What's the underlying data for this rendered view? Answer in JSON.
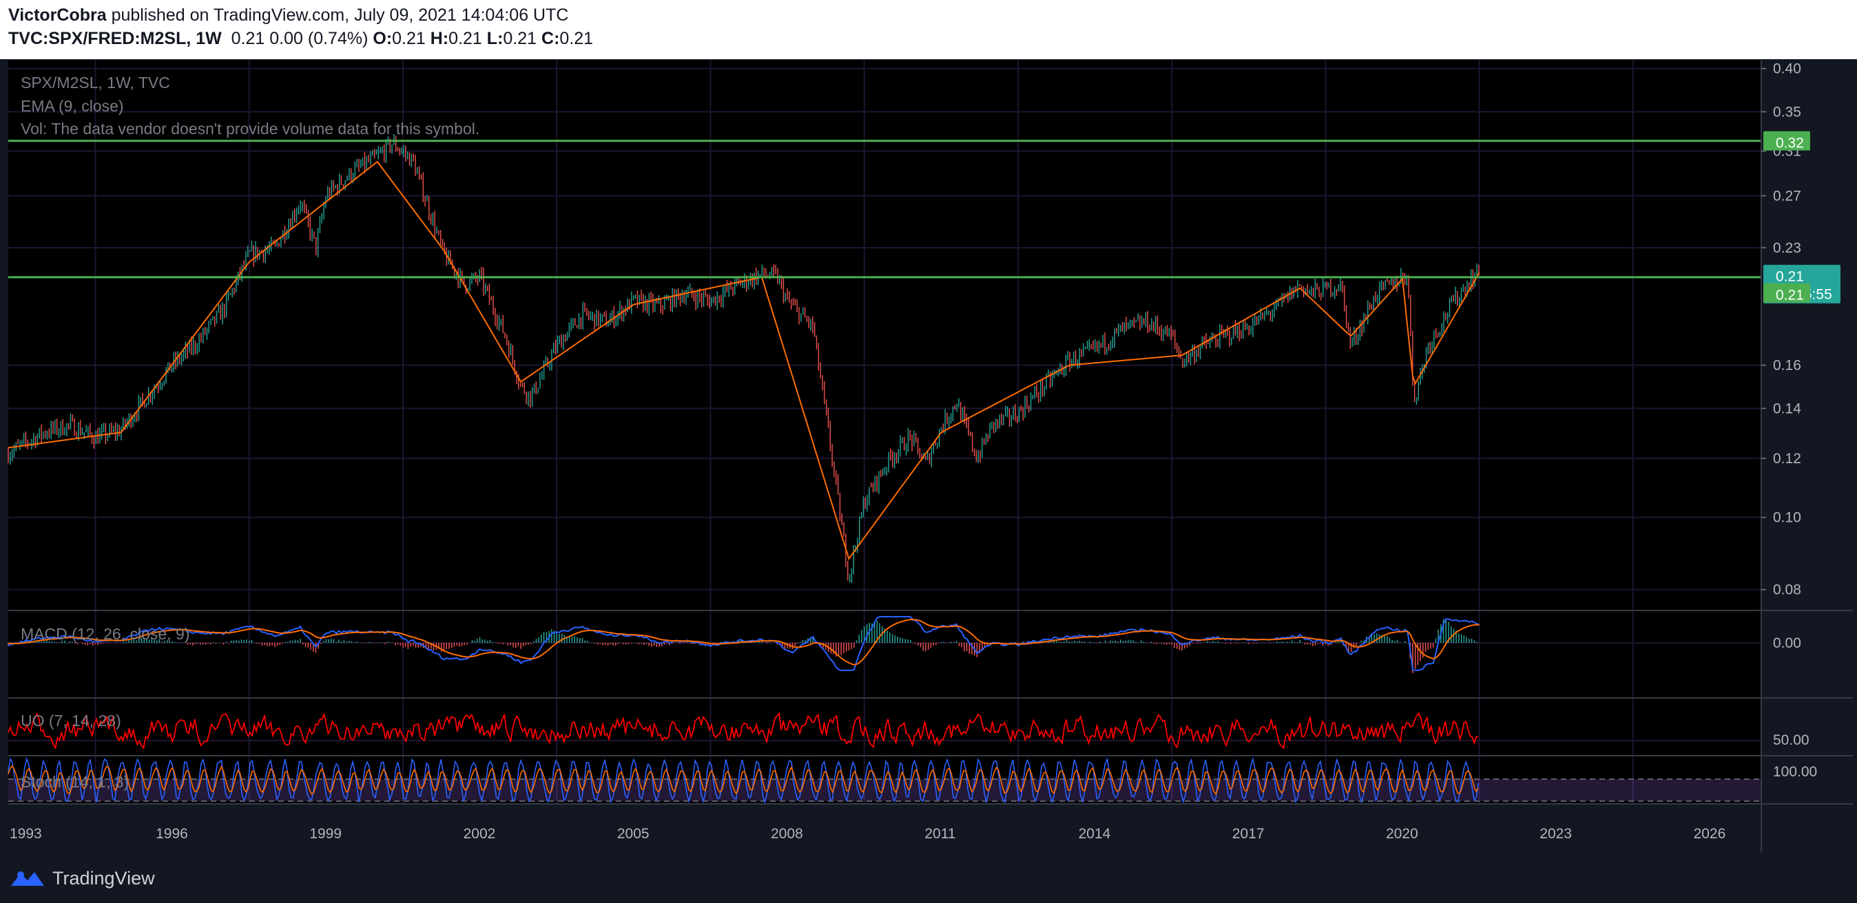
{
  "header": {
    "author": "VictorCobra",
    "published_text": "published on TradingView.com, July 09, 2021 14:04:06 UTC",
    "symbol": "TVC:SPX/FRED:M2SL, 1W",
    "last": "0.21",
    "change": "0.00 (0.74%)",
    "o_label": "O:",
    "o": "0.21",
    "h_label": "H:",
    "h": "0.21",
    "l_label": "L:",
    "l": "0.21",
    "c_label": "C:",
    "c": "0.21"
  },
  "legend": {
    "main": "SPX/M2SL, 1W, TVC",
    "ema": "EMA (9, close)",
    "vol": "Vol: The data vendor doesn't provide volume data for this symbol.",
    "macd": "MACD (12, 26, close, 9)",
    "uo": "UO (7, 14, 28)",
    "stoch": "Stoch (14, 1, 3)"
  },
  "price_axis": {
    "main_ticks": [
      "0.40",
      "0.35",
      "0.31",
      "0.27",
      "0.23",
      "0.16",
      "0.14",
      "0.12",
      "0.10",
      "0.08"
    ],
    "macd_tick": "0.00",
    "uo_tick": "50.00",
    "stoch_tick": "100.00",
    "last_price_label": "0.21",
    "countdown": "06:05:55",
    "hline_high_label": "0.32",
    "hline_low_label": "0.21",
    "ema_label": "0.21"
  },
  "time_axis": [
    "1993",
    "1996",
    "1999",
    "2002",
    "2005",
    "2008",
    "2011",
    "2014",
    "2017",
    "2020",
    "2023",
    "2026"
  ],
  "colors": {
    "background": "#000000",
    "page": "#131722",
    "grid": "#1f1530",
    "candle_up": "#26a69a",
    "candle_down": "#ef5350",
    "ema": "#ff6d00",
    "hline": "#4caf50",
    "last_price": "#26a69a",
    "macd": "#2962ff",
    "signal": "#ff6d00",
    "uo": "#ff0000",
    "stoch_k": "#2962ff",
    "stoch_d": "#ff6d00",
    "stoch_band": "#7e57c2"
  },
  "chart_data": {
    "type": "line",
    "title": "SPX/M2SL, 1W, TVC",
    "scale": "log",
    "ylim": [
      0.075,
      0.41
    ],
    "xlim": [
      1992.8,
      2027
    ],
    "horizontal_lines": [
      0.32,
      0.21
    ],
    "series": [
      {
        "name": "SPX/M2SL",
        "x": [
          1992.8,
          1993.5,
          1994.0,
          1994.5,
          1995.0,
          1995.5,
          1996.0,
          1996.5,
          1997.0,
          1997.5,
          1998.0,
          1998.5,
          1998.8,
          1999.0,
          1999.5,
          2000.0,
          2000.3,
          2000.7,
          2001.0,
          2001.3,
          2001.7,
          2002.0,
          2002.5,
          2002.8,
          2003.0,
          2003.5,
          2004.0,
          2004.5,
          2005.0,
          2005.5,
          2006.0,
          2006.5,
          2007.0,
          2007.5,
          2007.8,
          2008.0,
          2008.5,
          2008.8,
          2009.2,
          2009.5,
          2010.0,
          2010.4,
          2010.7,
          2011.0,
          2011.3,
          2011.7,
          2012.0,
          2012.5,
          2013.0,
          2013.5,
          2014.0,
          2014.5,
          2015.0,
          2015.5,
          2015.7,
          2016.1,
          2016.5,
          2017.0,
          2017.5,
          2018.0,
          2018.2,
          2018.8,
          2018.99,
          2019.5,
          2020.0,
          2020.1,
          2020.22,
          2020.5,
          2021.0,
          2021.5
        ],
        "y": [
          0.122,
          0.13,
          0.133,
          0.128,
          0.131,
          0.145,
          0.16,
          0.172,
          0.19,
          0.225,
          0.23,
          0.265,
          0.23,
          0.27,
          0.29,
          0.305,
          0.318,
          0.3,
          0.26,
          0.225,
          0.205,
          0.21,
          0.175,
          0.15,
          0.145,
          0.17,
          0.187,
          0.183,
          0.195,
          0.192,
          0.2,
          0.195,
          0.205,
          0.212,
          0.21,
          0.195,
          0.18,
          0.13,
          0.083,
          0.105,
          0.12,
          0.128,
          0.118,
          0.132,
          0.143,
          0.12,
          0.133,
          0.138,
          0.15,
          0.162,
          0.168,
          0.178,
          0.183,
          0.175,
          0.162,
          0.17,
          0.175,
          0.18,
          0.19,
          0.205,
          0.2,
          0.205,
          0.17,
          0.2,
          0.21,
          0.213,
          0.143,
          0.17,
          0.195,
          0.215
        ]
      },
      {
        "name": "EMA (9, close)",
        "x": [
          1992.8,
          1995.0,
          1997.5,
          2000.0,
          2001.3,
          2002.8,
          2005.0,
          2007.5,
          2009.2,
          2011.0,
          2013.5,
          2015.7,
          2018.0,
          2018.99,
          2020.0,
          2020.22,
          2021.5
        ],
        "y": [
          0.124,
          0.13,
          0.22,
          0.3,
          0.228,
          0.152,
          0.193,
          0.21,
          0.088,
          0.13,
          0.16,
          0.165,
          0.203,
          0.175,
          0.209,
          0.15,
          0.213
        ]
      }
    ]
  }
}
